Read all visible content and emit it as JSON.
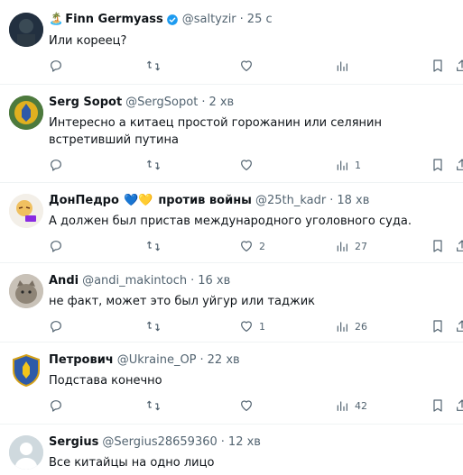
{
  "tweets": [
    {
      "name": "Finn Germyass",
      "name_prefix": "🏝️",
      "verified": true,
      "handle": "@saltyzir",
      "time": "25 с",
      "text": "Или кореец?",
      "likes": "",
      "views": ""
    },
    {
      "name": "Serg Sopot",
      "handle": "@SergSopot",
      "time": "2 хв",
      "text": "Интересно а китаец простой горожанин или селянин встретивший путина",
      "likes": "",
      "views": "1"
    },
    {
      "name": "ДонПедро",
      "name_suffix_emoji": "💙💛",
      "name_suffix": "против войны",
      "handle": "@25th_kadr",
      "time": "18 хв",
      "text": "А должен был пристав международного уголовного суда.",
      "likes": "2",
      "views": "27"
    },
    {
      "name": "Andi",
      "handle": "@andi_makintoch",
      "time": "16 хв",
      "text": "не факт, может это был уйгур или таджик",
      "likes": "1",
      "views": "26"
    },
    {
      "name": "Петрович",
      "handle": "@Ukraine_OP",
      "time": "22 хв",
      "text": "Подстава конечно",
      "likes": "",
      "views": "42"
    },
    {
      "name": "Sergius",
      "handle": "@Sergius28659360",
      "time": "12 хв",
      "text": "Все китайцы на одно лицо",
      "likes": "",
      "views": ""
    }
  ],
  "separator": "·",
  "colors": {
    "text": "#0f1419",
    "secondary": "#536471",
    "verified": "#1d9bf0",
    "divider": "#eff3f4"
  }
}
